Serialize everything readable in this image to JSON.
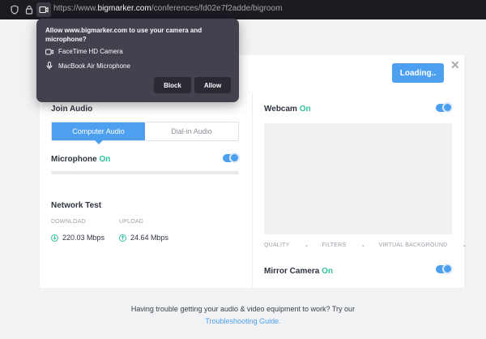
{
  "browser": {
    "url_prefix": "https://www.",
    "url_domain": "bigmarker.com",
    "url_path": "/conferences/fd02e7f2adde/bigroom"
  },
  "permission_popup": {
    "title": "Allow www.bigmarker.com to use your camera and microphone?",
    "camera_label": "FaceTime HD Camera",
    "microphone_label": "MacBook Air Microphone",
    "block_label": "Block",
    "allow_label": "Allow"
  },
  "header": {
    "loading_label": "Loading..",
    "close_label": "✕"
  },
  "audio": {
    "heading": "Join Audio",
    "tabs": [
      {
        "label": "Computer Audio",
        "active": true
      },
      {
        "label": "Dial-in Audio",
        "active": false
      }
    ],
    "microphone_label": "Microphone",
    "microphone_state": "On"
  },
  "network": {
    "heading": "Network Test",
    "download_label": "DOWNLOAD",
    "download_value": "220.03 Mbps",
    "upload_label": "UPLOAD",
    "upload_value": "24.64 Mbps"
  },
  "webcam": {
    "label": "Webcam",
    "state": "On",
    "options": [
      "QUALITY",
      "FILTERS",
      "VIRTUAL BACKGROUND"
    ],
    "mirror_label": "Mirror Camera",
    "mirror_state": "On"
  },
  "footer": {
    "help_text": "Having trouble getting your audio & video equipment to work? Try our",
    "link_text": "Troubleshooting Guide."
  },
  "colors": {
    "accent": "#4d9ff0",
    "on_green": "#33c0a0",
    "popup_bg": "#42414d"
  }
}
